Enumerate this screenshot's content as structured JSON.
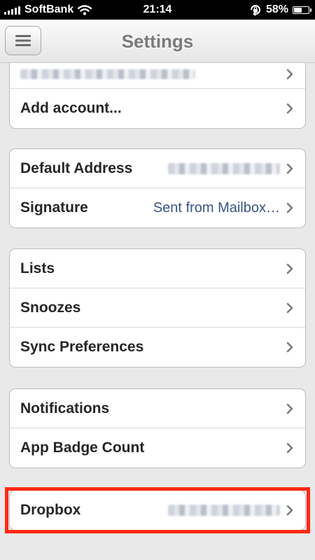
{
  "status_bar": {
    "carrier": "SoftBank",
    "time": "21:14",
    "battery": "58%",
    "battery_level": 0.58
  },
  "nav": {
    "title": "Settings",
    "menu_icon": "menu-icon"
  },
  "accounts": {
    "add_account": "Add account..."
  },
  "identity": {
    "default_address": "Default Address",
    "signature": "Signature",
    "signature_value": "Sent from Mailbox…"
  },
  "organization": {
    "lists": "Lists",
    "snoozes": "Snoozes",
    "sync_preferences": "Sync Preferences"
  },
  "alerts": {
    "notifications": "Notifications",
    "app_badge_count": "App Badge Count"
  },
  "services": {
    "dropbox": "Dropbox"
  },
  "colors": {
    "highlight": "#ff2a14",
    "value_text": "#385587",
    "title_text": "#7a7a7a"
  }
}
